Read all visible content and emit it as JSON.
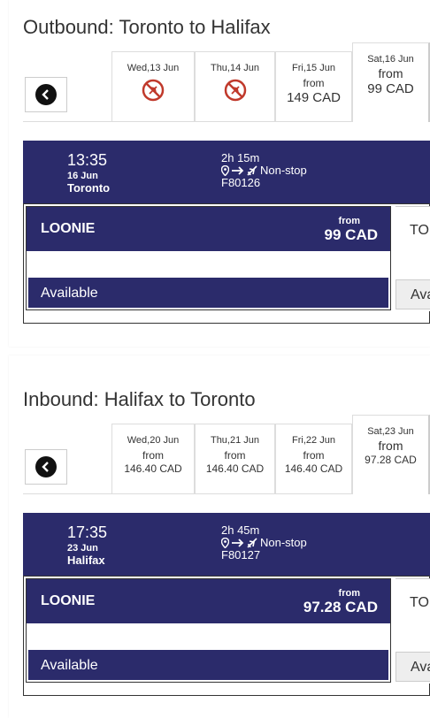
{
  "colors": {
    "brand_navy": "#2b2b6b",
    "no_flight_red": "#c0392b"
  },
  "outbound": {
    "title": "Outbound: Toronto to Halifax",
    "tabs": [
      {
        "label": "Wed,13 Jun",
        "status": "no-flight"
      },
      {
        "label": "Thu,14 Jun",
        "status": "no-flight"
      },
      {
        "label": "Fri,15 Jun",
        "from": "from",
        "price": "149 CAD"
      },
      {
        "label": "Sat,16 Jun",
        "from": "from",
        "price": "99 CAD",
        "selected": true
      }
    ],
    "flight": {
      "time": "13:35",
      "date": "16 Jun",
      "city": "Toronto",
      "duration": "2h 15m",
      "stops": "Non-stop",
      "flight_no": "F80126"
    },
    "fare": {
      "name": "LOONIE",
      "from": "from",
      "price": "99 CAD",
      "availability": "Available",
      "next_name": "TO",
      "next_avail": "Ava"
    }
  },
  "inbound": {
    "title": "Inbound: Halifax to Toronto",
    "tabs": [
      {
        "label": "Wed,20 Jun",
        "from": "from",
        "price": "146.40 CAD"
      },
      {
        "label": "Thu,21 Jun",
        "from": "from",
        "price": "146.40 CAD"
      },
      {
        "label": "Fri,22 Jun",
        "from": "from",
        "price": "146.40 CAD"
      },
      {
        "label": "Sat,23 Jun",
        "from": "from",
        "price": "97.28 CAD",
        "selected": true
      }
    ],
    "flight": {
      "time": "17:35",
      "date": "23 Jun",
      "city": "Halifax",
      "duration": "2h 45m",
      "stops": "Non-stop",
      "flight_no": "F80127"
    },
    "fare": {
      "name": "LOONIE",
      "from": "from",
      "price": "97.28 CAD",
      "availability": "Available",
      "next_name": "TO",
      "next_avail": "Ava"
    }
  }
}
